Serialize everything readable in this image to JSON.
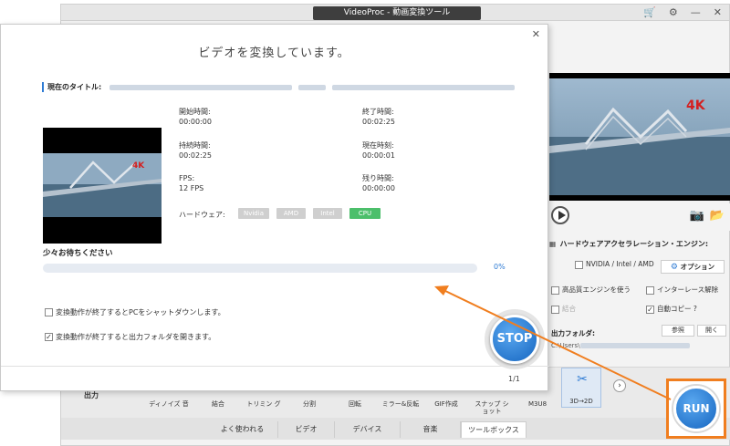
{
  "app": {
    "title": "VideoProc - 動画変換ツール",
    "window_icons": {
      "cart": "cart-icon",
      "settings": "gear-icon",
      "minimize": "—",
      "close": "✕"
    }
  },
  "preview": {
    "video_badge": "4K"
  },
  "hw_panel": {
    "title": "ハードウェアアクセラレーション・エンジン:",
    "nvidia_label": "NVIDIA / Intel / AMD",
    "option_label": "オプション",
    "hq_engine": "高品質エンジンを使う",
    "deinterlace": "インターレース解除",
    "merge": "結合",
    "autocopy": "自動コピー ?",
    "output_folder_label": "出力フォルダ:",
    "browse": "参照",
    "open": "開く",
    "output_path_prefix": "C:\\Users\\"
  },
  "toolbar": {
    "output_tab": "出力",
    "tools": [
      {
        "label": "ディノイズ 音"
      },
      {
        "label": "結合"
      },
      {
        "label": "トリミン グ"
      },
      {
        "label": "分割"
      },
      {
        "label": "回転"
      },
      {
        "label": "ミラー&反転"
      },
      {
        "label": "GIF作成"
      },
      {
        "label": "スナップ ショット"
      },
      {
        "label": "M3U8"
      },
      {
        "label": "3D→2D"
      }
    ],
    "next": "›"
  },
  "tabs": [
    "よく使われる",
    "ビデオ",
    "デバイス",
    "音楽",
    "ツールボックス"
  ],
  "dialog": {
    "title": "ビデオを変換しています。",
    "close": "✕",
    "current_title_label": "現在のタイトル:",
    "start_label": "開始時間:",
    "start_value": "00:00:00",
    "end_label": "終了時間:",
    "end_value": "00:02:25",
    "duration_label": "持続時間:",
    "duration_value": "00:02:25",
    "current_label": "現在時刻:",
    "current_value": "00:00:01",
    "fps_label": "FPS:",
    "fps_value": "12 FPS",
    "remaining_label": "残り時間:",
    "remaining_value": "00:00:00",
    "hw_label": "ハードウェア:",
    "hw_badges": [
      "Nvidia",
      "AMD",
      "Intel",
      "CPU"
    ],
    "wait_label": "少々お待ちください",
    "progress": 0,
    "progress_text": "0%",
    "shutdown_label": "変換動作が終了するとPCをシャットダウンします。",
    "open_folder_label": "変換動作が終了すると出力フォルダを開きます。",
    "stop_label": "STOP",
    "pager": "1/1"
  },
  "run_label": "RUN",
  "colors": {
    "accent": "#2e7bd4",
    "run_border": "#f07e1f",
    "cpu_badge": "#4cbf6b",
    "progress_track": "#e6ebf2"
  }
}
